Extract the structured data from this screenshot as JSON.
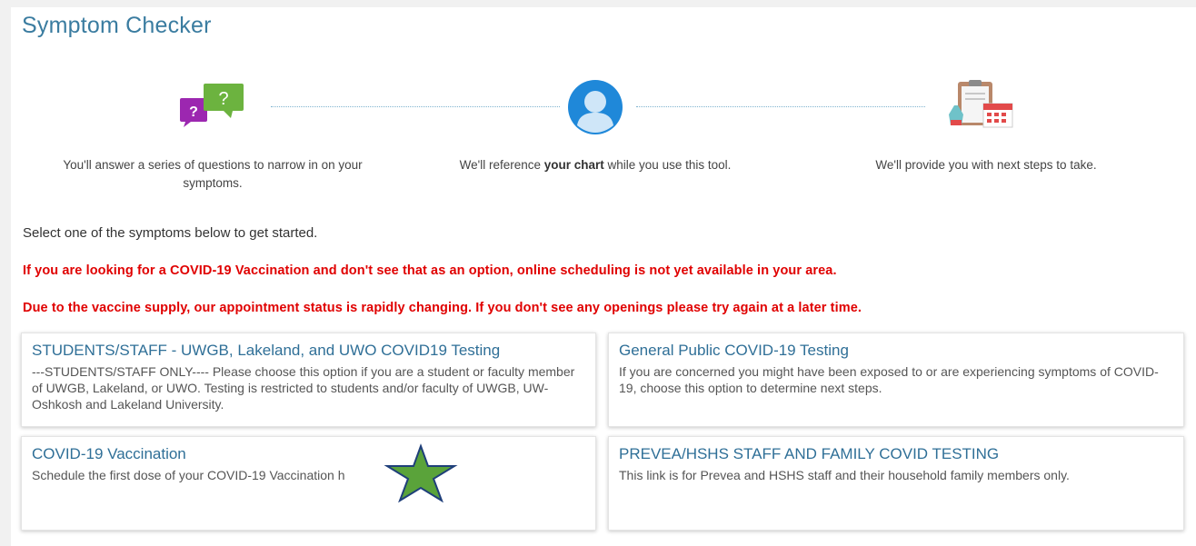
{
  "page": {
    "title": "Symptom Checker"
  },
  "steps": [
    {
      "icon": "question-bubbles-icon",
      "text": "You'll answer a series of questions to narrow in on your symptoms."
    },
    {
      "icon": "user-avatar-icon",
      "text_before": "We'll reference ",
      "text_bold": "your chart",
      "text_after": " while you use this tool."
    },
    {
      "icon": "clipboard-calendar-icon",
      "text": "We'll provide you with next steps to take."
    }
  ],
  "intro": "Select one of the symptoms below to get started.",
  "alerts": [
    "If you are looking for a COVID-19 Vaccination and don't see that as an option, online scheduling is not yet available in your area.",
    "Due to the vaccine supply, our appointment status is rapidly changing. If you don't see any openings please try again at a later time."
  ],
  "options": [
    {
      "title": "STUDENTS/STAFF - UWGB, Lakeland, and UWO COVID19 Testing",
      "description": "---STUDENTS/STAFF ONLY---- Please choose this option if you are a student or faculty member of UWGB, Lakeland, or UWO. Testing is restricted to students and/or faculty of UWGB, UW-Oshkosh and Lakeland University."
    },
    {
      "title": "General Public COVID-19 Testing",
      "description": "If you are concerned you might have been exposed to or are experiencing symptoms of COVID-19, choose this option to determine next steps."
    },
    {
      "title": "COVID-19 Vaccination",
      "description": "Schedule the first dose of your COVID-19 Vaccination h"
    },
    {
      "title": "PREVEA/HSHS STAFF AND FAMILY COVID TESTING",
      "description": "This link is for Prevea and HSHS staff and their household family members only."
    }
  ],
  "colors": {
    "title": "#3a7ca0",
    "alert": "#e00000",
    "card_title": "#2f6f97",
    "star_fill": "#5aa33a",
    "star_stroke": "#1f3f7a"
  }
}
